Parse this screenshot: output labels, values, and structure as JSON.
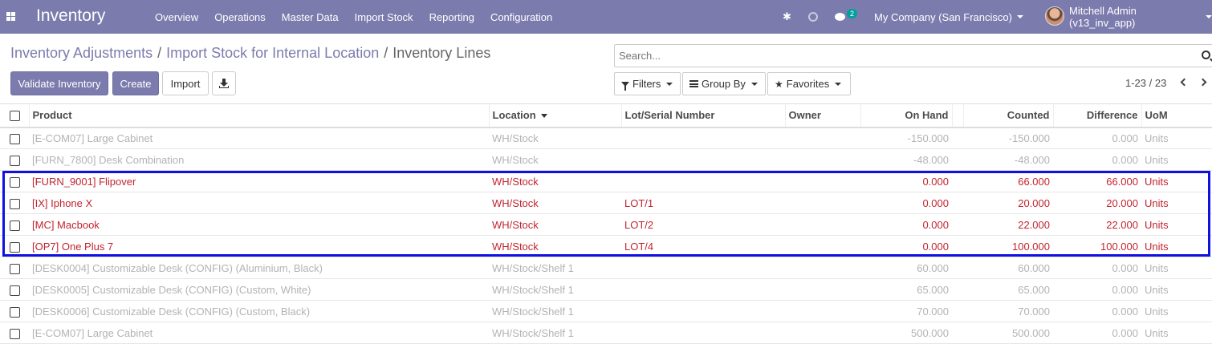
{
  "navbar": {
    "brand": "Inventory",
    "menu": [
      "Overview",
      "Operations",
      "Master Data",
      "Import Stock",
      "Reporting",
      "Configuration"
    ],
    "chat_count": "2",
    "company": "My Company (San Francisco)",
    "user": "Mitchell Admin (v13_inv_app)",
    "accent": "#7c7bad"
  },
  "breadcrumb": {
    "items": [
      "Inventory Adjustments",
      "Import Stock for Internal Location"
    ],
    "separator": "/",
    "current": "Inventory Lines"
  },
  "buttons": {
    "validate": "Validate Inventory",
    "create": "Create",
    "import": "Import",
    "download_icon": "download-icon"
  },
  "search": {
    "placeholder": "Search..."
  },
  "filters": {
    "filters": "Filters",
    "group_by": "Group By",
    "favorites": "Favorites"
  },
  "pager": {
    "value": "1-23 / 23"
  },
  "table": {
    "columns": {
      "product": "Product",
      "location": "Location",
      "lot": "Lot/Serial Number",
      "owner": "Owner",
      "on_hand": "On Hand",
      "counted": "Counted",
      "difference": "Difference",
      "uom": "UoM"
    },
    "rows": [
      {
        "product": "[E-COM07] Large Cabinet",
        "location": "WH/Stock",
        "lot": "",
        "owner": "",
        "on_hand": "-150.000",
        "counted": "-150.000",
        "difference": "0.000",
        "uom": "Units",
        "state": "muted"
      },
      {
        "product": "[FURN_7800] Desk Combination",
        "location": "WH/Stock",
        "lot": "",
        "owner": "",
        "on_hand": "-48.000",
        "counted": "-48.000",
        "difference": "0.000",
        "uom": "Units",
        "state": "muted"
      },
      {
        "product": "[FURN_9001] Flipover",
        "location": "WH/Stock",
        "lot": "",
        "owner": "",
        "on_hand": "0.000",
        "counted": "66.000",
        "difference": "66.000",
        "uom": "Units",
        "state": "danger"
      },
      {
        "product": "[IX] Iphone X",
        "location": "WH/Stock",
        "lot": "LOT/1",
        "owner": "",
        "on_hand": "0.000",
        "counted": "20.000",
        "difference": "20.000",
        "uom": "Units",
        "state": "danger"
      },
      {
        "product": "[MC] Macbook",
        "location": "WH/Stock",
        "lot": "LOT/2",
        "owner": "",
        "on_hand": "0.000",
        "counted": "22.000",
        "difference": "22.000",
        "uom": "Units",
        "state": "danger"
      },
      {
        "product": "[OP7] One Plus 7",
        "location": "WH/Stock",
        "lot": "LOT/4",
        "owner": "",
        "on_hand": "0.000",
        "counted": "100.000",
        "difference": "100.000",
        "uom": "Units",
        "state": "danger"
      },
      {
        "product": "[DESK0004] Customizable Desk (CONFIG) (Aluminium, Black)",
        "location": "WH/Stock/Shelf 1",
        "lot": "",
        "owner": "",
        "on_hand": "60.000",
        "counted": "60.000",
        "difference": "0.000",
        "uom": "Units",
        "state": "muted"
      },
      {
        "product": "[DESK0005] Customizable Desk (CONFIG) (Custom, White)",
        "location": "WH/Stock/Shelf 1",
        "lot": "",
        "owner": "",
        "on_hand": "65.000",
        "counted": "65.000",
        "difference": "0.000",
        "uom": "Units",
        "state": "muted"
      },
      {
        "product": "[DESK0006] Customizable Desk (CONFIG) (Custom, Black)",
        "location": "WH/Stock/Shelf 1",
        "lot": "",
        "owner": "",
        "on_hand": "70.000",
        "counted": "70.000",
        "difference": "0.000",
        "uom": "Units",
        "state": "muted"
      },
      {
        "product": "[E-COM07] Large Cabinet",
        "location": "WH/Stock/Shelf 1",
        "lot": "",
        "owner": "",
        "on_hand": "500.000",
        "counted": "500.000",
        "difference": "0.000",
        "uom": "Units",
        "state": "muted"
      }
    ],
    "colors": {
      "muted": "#b3b3b3",
      "danger": "#c2242f",
      "highlight": "#1010e0"
    }
  }
}
